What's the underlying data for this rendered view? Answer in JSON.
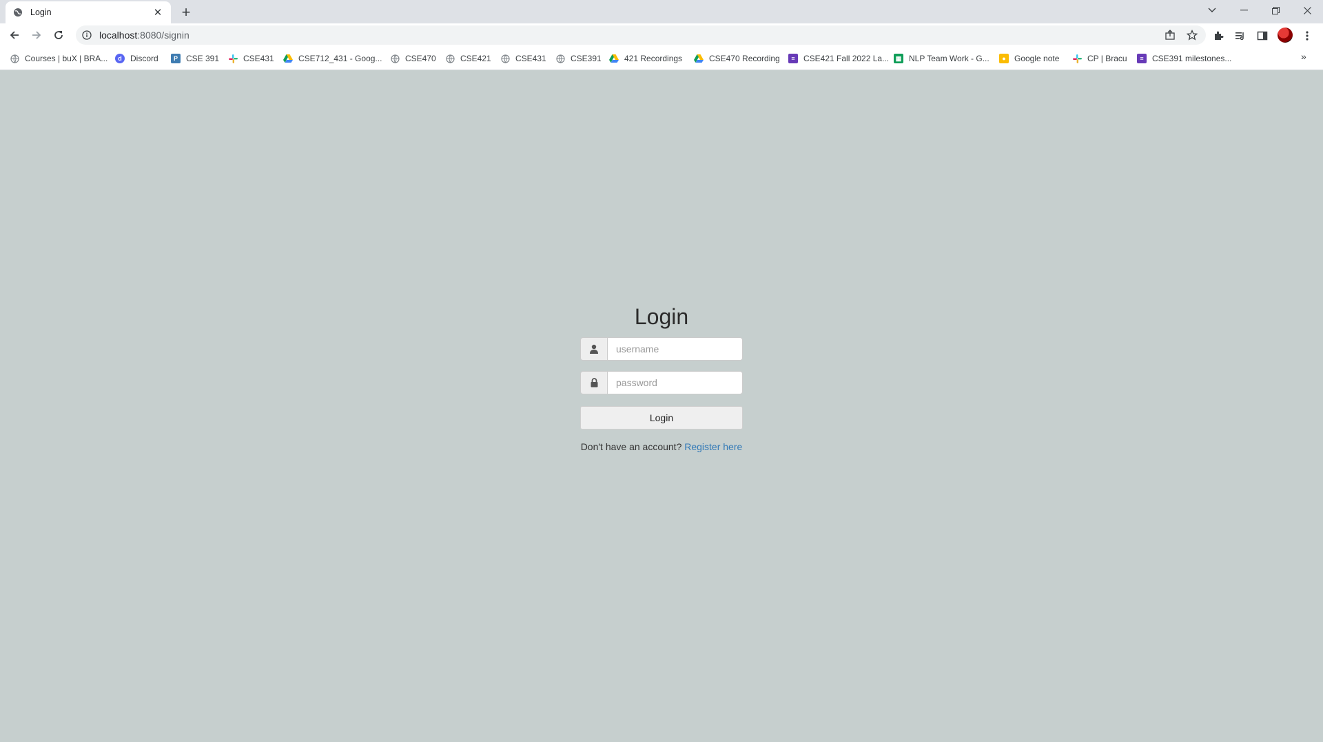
{
  "browser": {
    "tab": {
      "title": "Login"
    },
    "url": {
      "host": "localhost",
      "path": ":8080/signin"
    },
    "bookmarks": [
      {
        "label": "Courses | buX | BRA...",
        "icon": "globe-icon"
      },
      {
        "label": "Discord",
        "icon": "discord-icon"
      },
      {
        "label": "CSE 391",
        "icon": "piazza-icon"
      },
      {
        "label": "CSE431",
        "icon": "slack-icon"
      },
      {
        "label": "CSE712_431 - Goog...",
        "icon": "google-drive-icon"
      },
      {
        "label": "CSE470",
        "icon": "globe-icon"
      },
      {
        "label": "CSE421",
        "icon": "globe-icon"
      },
      {
        "label": "CSE431",
        "icon": "globe-icon"
      },
      {
        "label": "CSE391",
        "icon": "globe-icon"
      },
      {
        "label": "421 Recordings",
        "icon": "google-drive-icon"
      },
      {
        "label": "CSE470 Recording",
        "icon": "google-drive-icon"
      },
      {
        "label": "CSE421 Fall 2022 La...",
        "icon": "google-forms-icon"
      },
      {
        "label": "NLP Team Work - G...",
        "icon": "google-sheets-icon"
      },
      {
        "label": "Google note",
        "icon": "google-keep-icon"
      },
      {
        "label": "CP | Bracu",
        "icon": "slack-icon"
      },
      {
        "label": "CSE391 milestones...",
        "icon": "google-forms-icon"
      }
    ]
  },
  "login": {
    "title": "Login",
    "username_placeholder": "username",
    "password_placeholder": "password",
    "button_label": "Login",
    "register_prompt": "Don't have an account?",
    "register_link": "Register here"
  },
  "colors": {
    "page_background": "#c6cfce",
    "link": "#337ab7"
  }
}
